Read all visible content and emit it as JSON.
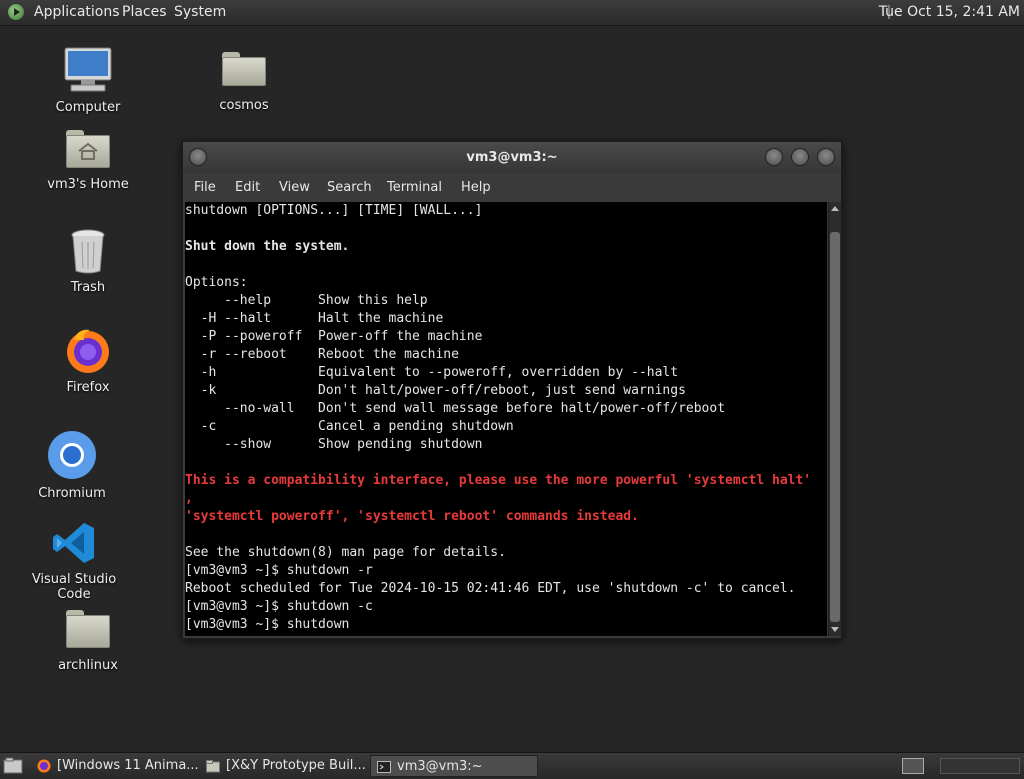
{
  "top_panel": {
    "menus": [
      "Applications",
      "Places",
      "System"
    ],
    "clock": "Tue Oct 15,  2:41 AM"
  },
  "desktop_icons": [
    {
      "label": "Computer",
      "icon": "computer-icon"
    },
    {
      "label": "cosmos",
      "icon": "folder-icon"
    },
    {
      "label": "vm3's Home",
      "icon": "home-folder-icon"
    },
    {
      "label": "Trash",
      "icon": "trash-icon"
    },
    {
      "label": "Firefox",
      "icon": "firefox-icon"
    },
    {
      "label": "Chromium",
      "icon": "chromium-icon"
    },
    {
      "label": "Visual Studio Code",
      "icon": "vscode-icon"
    },
    {
      "label": "archlinux",
      "icon": "folder-icon"
    }
  ],
  "terminal": {
    "title": "vm3@vm3:~",
    "menu": [
      "File",
      "Edit",
      "View",
      "Search",
      "Terminal",
      "Help"
    ],
    "lines": [
      {
        "text": "shutdown [OPTIONS...] [TIME] [WALL...]",
        "style": "normal"
      },
      {
        "text": "",
        "style": "normal"
      },
      {
        "text": "Shut down the system.",
        "style": "bold"
      },
      {
        "text": "",
        "style": "normal"
      },
      {
        "text": "Options:",
        "style": "normal"
      },
      {
        "text": "     --help      Show this help",
        "style": "normal"
      },
      {
        "text": "  -H --halt      Halt the machine",
        "style": "normal"
      },
      {
        "text": "  -P --poweroff  Power-off the machine",
        "style": "normal"
      },
      {
        "text": "  -r --reboot    Reboot the machine",
        "style": "normal"
      },
      {
        "text": "  -h             Equivalent to --poweroff, overridden by --halt",
        "style": "normal"
      },
      {
        "text": "  -k             Don't halt/power-off/reboot, just send warnings",
        "style": "normal"
      },
      {
        "text": "     --no-wall   Don't send wall message before halt/power-off/reboot",
        "style": "normal"
      },
      {
        "text": "  -c             Cancel a pending shutdown",
        "style": "normal"
      },
      {
        "text": "     --show      Show pending shutdown",
        "style": "normal"
      },
      {
        "text": "",
        "style": "normal"
      },
      {
        "text": "This is a compatibility interface, please use the more powerful 'systemctl halt'",
        "style": "red"
      },
      {
        "text": ",",
        "style": "red"
      },
      {
        "text": "'systemctl poweroff', 'systemctl reboot' commands instead.",
        "style": "red"
      },
      {
        "text": "",
        "style": "normal"
      },
      {
        "text": "See the shutdown(8) man page for details.",
        "style": "normal"
      },
      {
        "text": "[vm3@vm3 ~]$ shutdown -r",
        "style": "normal"
      },
      {
        "text": "Reboot scheduled for Tue 2024-10-15 02:41:46 EDT, use 'shutdown -c' to cancel.",
        "style": "normal"
      },
      {
        "text": "[vm3@vm3 ~]$ shutdown -c",
        "style": "normal"
      },
      {
        "text": "[vm3@vm3 ~]$ shutdown",
        "style": "normal"
      }
    ]
  },
  "taskbar": {
    "items": [
      {
        "label": "[Windows 11 Anima...",
        "icon": "firefox-icon",
        "active": false
      },
      {
        "label": "[X&Y Prototype Buil...",
        "icon": "folder-icon",
        "active": false
      },
      {
        "label": "vm3@vm3:~",
        "icon": "terminal-icon",
        "active": true
      }
    ]
  },
  "colors": {
    "desktop": "#262626",
    "terminal_bg": "#000000",
    "terminal_fg": "#e6e6e6",
    "warning_red": "#e83a3a"
  }
}
